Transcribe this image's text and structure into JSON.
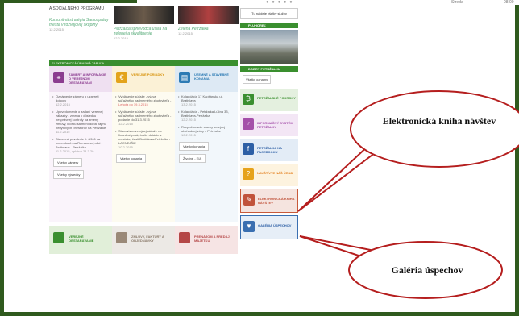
{
  "topbar": {
    "dots": "● ● ● ● ●",
    "day": "Streda",
    "time": "08:00"
  },
  "news": [
    {
      "heading": "A SOCIÁLNEHO PROGRAMU",
      "title": "Komunitná stratégia Samosprávy mesta v rozvojovej skupiny",
      "date": "12.2.2015"
    },
    {
      "heading": "",
      "title": "Petržalka sprievodca úsilia na zelenej a skvalitnenie",
      "date": "12.2.2015"
    },
    {
      "heading": "",
      "title": "Zelená Petržalka",
      "date": "12.2.2015"
    }
  ],
  "board_title": "ELEKTRONICKÁ ÚRADNÁ TABUĽA",
  "columns": [
    {
      "title": "ZÁMERY A INFORMÁCIE O VEREJNOM OBSTARÁVANÍ",
      "items": [
        {
          "text": "Oznámenie zámeru o uzavretí dohody",
          "date": "12.2.2015"
        },
        {
          "text": "Upovedomenie o zadaní verejnej zákazky - zmena v dôsledku nesprávnej kontroly na zmeny zmluvy, ktorou sa mení doba nájmu nebytových priestorov na Petržalke",
          "date": "11.2.2015"
        },
        {
          "text": "Stavebné povolenie č. 8/1-6 na pozemkoch na Romanovej ulici v Bratislave - Petržalka",
          "date": "11.2.2015, uplatná 24.3.20"
        }
      ],
      "buttons": [
        "Všetky zámery",
        "Všetky výsledky"
      ]
    },
    {
      "title": "VEREJNÉ PORIADKY",
      "items": [
        {
          "text": "Vyhlásenie súťaže - výzva súťažného nadmerného zhotoviteľa -",
          "date": "Lehota do 19.3.2015"
        },
        {
          "text": "Vyhlásenie súťaže - výzva súťažného nadmerného zhotoviteľa - podanie do 31.3.2015",
          "date": "12.2.2015"
        },
        {
          "text": "Stanovisko verejnej súťaže na finančné poskytnutie dotácie z mestskej časti Bratislava-Petržalka - LACNEJŠIE",
          "date": "10.2.2015"
        }
      ],
      "buttons": [
        "Všetky konania"
      ]
    },
    {
      "title": "ÚZEMNÉ A STAVEBNÉ KONANIA",
      "items": [
        {
          "text": "Kolaudácia 17 Kapitánska ul. Bratislava",
          "date": "13.2.2015"
        },
        {
          "text": "Kolaudácia - Petržalka Lúčna 33, Bratislava-Petržalka",
          "date": "12.2.2015"
        },
        {
          "text": "Rozpočtovanie stavby verejnej obchodnej zóny v Petržalke",
          "date": "10.2.2015"
        }
      ],
      "buttons": [
        "Všetky konania",
        "Životné - EIA"
      ]
    }
  ],
  "bottom_cells": [
    {
      "label": "VEREJNÉ OBSTARÁVANIE"
    },
    {
      "label": "ZMLUVY, FAKTÚRY A OBJEDNÁVKY"
    },
    {
      "label": "PRENÁJOM A PREDAJ MAJETKU"
    }
  ],
  "right": {
    "top_button": "Tu nájdete všetky služby",
    "pluhared_heading": "PLUHOREĽ",
    "news_heading": "DOBRÝ PETRŽALKU",
    "all_button": "Všetky oznamy",
    "links": [
      {
        "label": "PETRŽALSKÉ POKROKY",
        "icon": "₿"
      },
      {
        "label": "INFORMAČNÝ SYSTÉM PETRŽALKY",
        "icon": "♂"
      },
      {
        "label": "PETRŽALKA NA FACEBOOKU",
        "icon": "f"
      },
      {
        "label": "NAVŠTÍVTE NÁŠ ÚRAD",
        "icon": "?"
      },
      {
        "label": "ELEKTRONICKÁ KNIHA NÁVŠTEV",
        "icon": "✎"
      },
      {
        "label": "GALÉRIA ÚSPECHOV",
        "icon": "▼"
      }
    ]
  },
  "callouts": {
    "top": "Elektronická kniha návštev",
    "bottom": "Galéria úspechov"
  }
}
